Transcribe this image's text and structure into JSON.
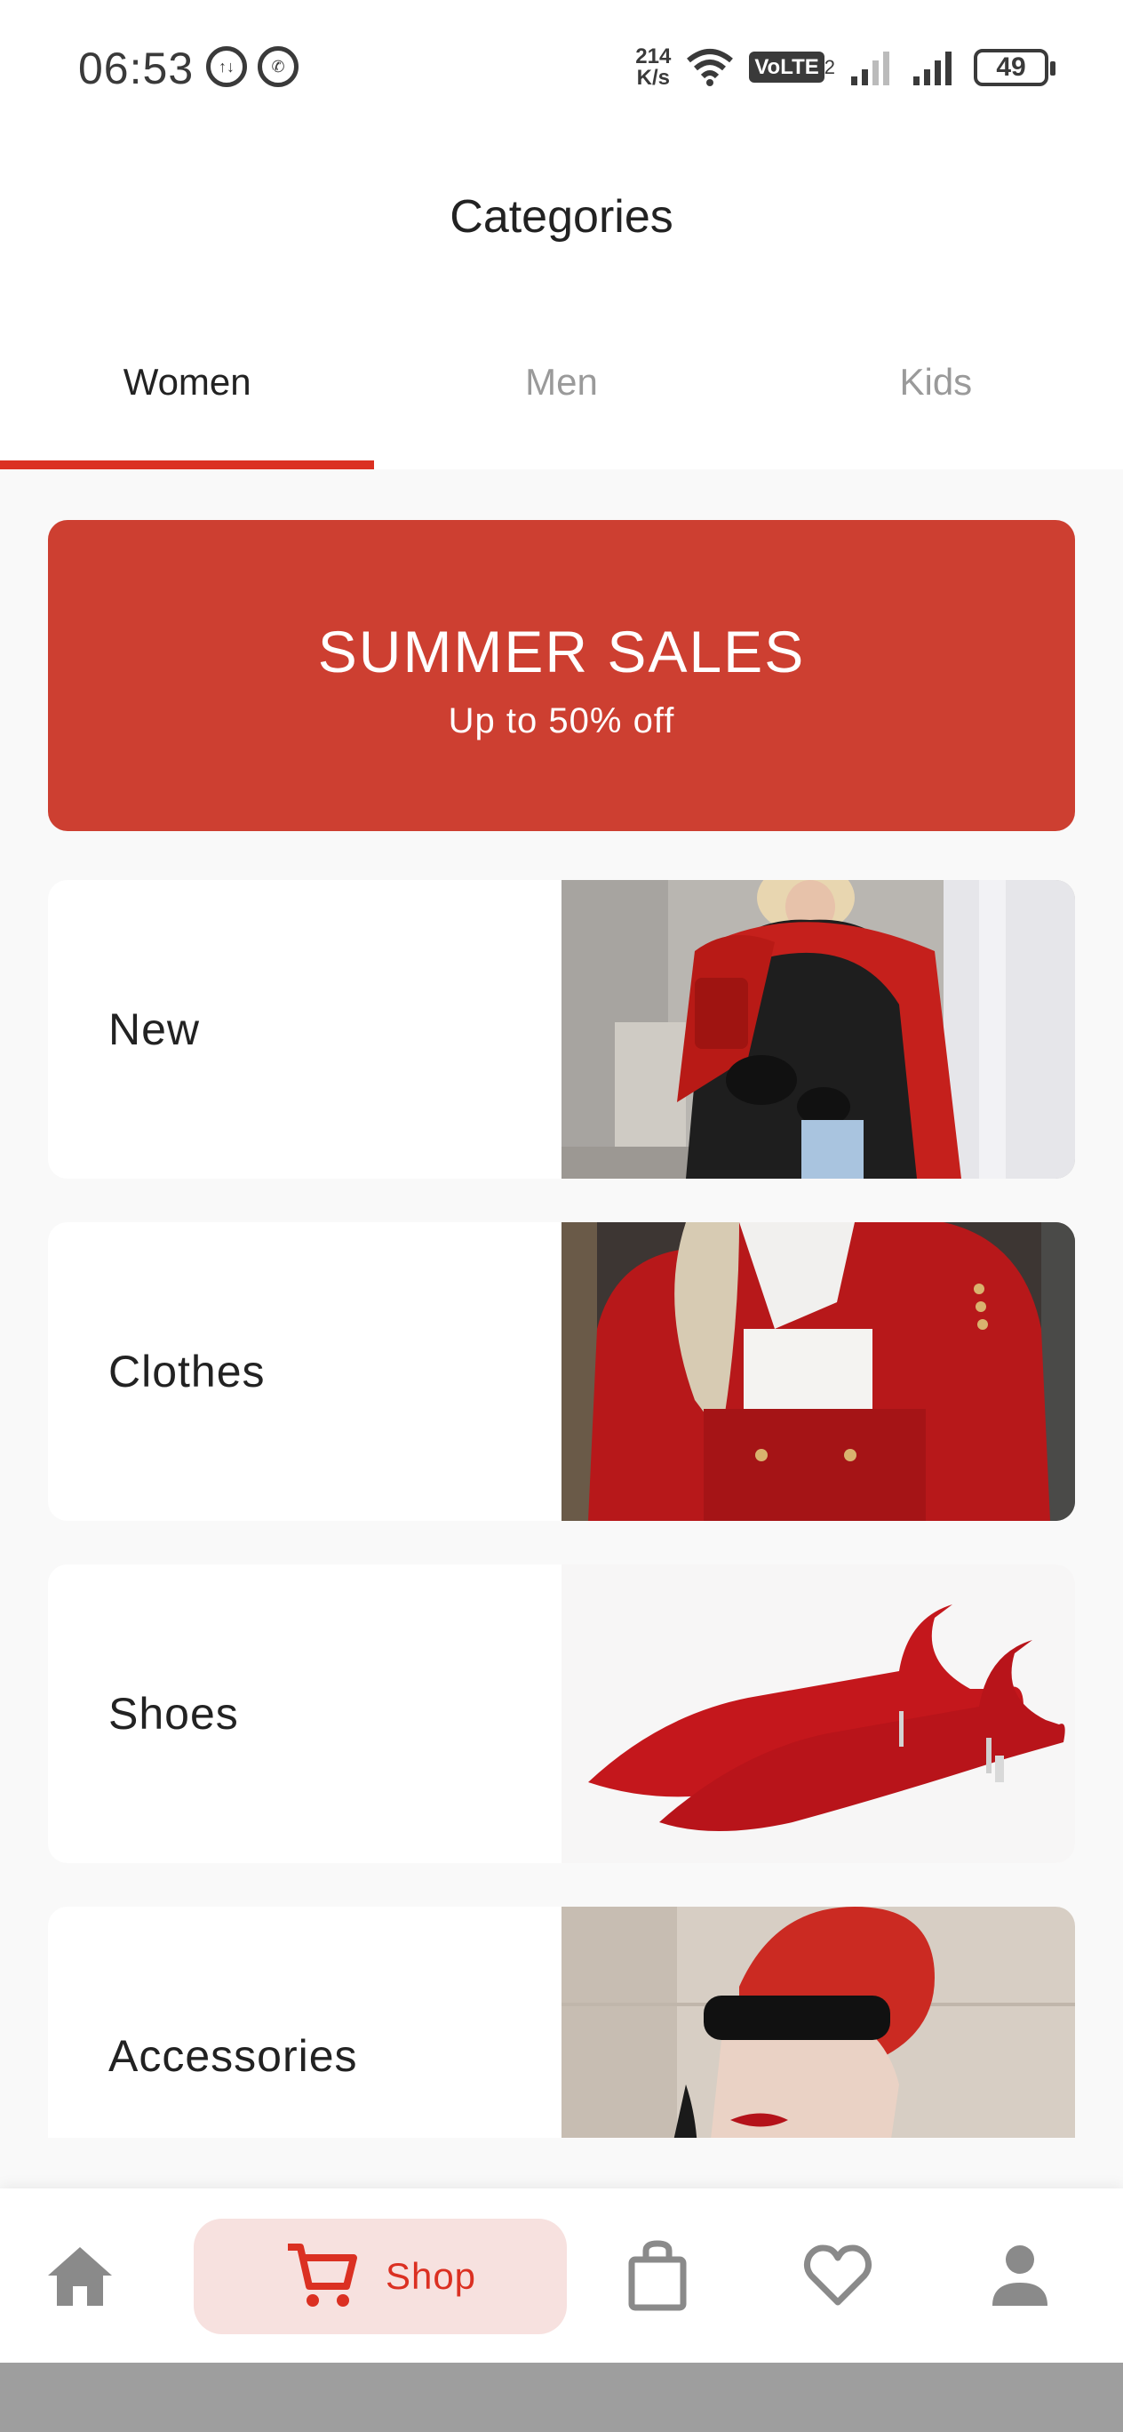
{
  "status_bar": {
    "time": "06:53",
    "net_speed_top": "214",
    "net_speed_bottom": "K/s",
    "volte": "VoLTE",
    "sim_index": "2",
    "battery": "49"
  },
  "header": {
    "title": "Categories"
  },
  "tabs": [
    {
      "label": "Women",
      "active": true
    },
    {
      "label": "Men",
      "active": false
    },
    {
      "label": "Kids",
      "active": false
    }
  ],
  "banner": {
    "title": "SUMMER SALES",
    "subtitle": "Up to 50% off"
  },
  "categories": [
    {
      "label": "New"
    },
    {
      "label": "Clothes"
    },
    {
      "label": "Shoes"
    },
    {
      "label": "Accessories"
    }
  ],
  "bottom_nav": {
    "items": [
      "home-icon",
      "cart-icon",
      "bag-icon",
      "heart-icon",
      "profile-icon"
    ],
    "shop_label": "Shop"
  },
  "colors": {
    "accent": "#db3022",
    "banner": "#cd3f31",
    "pill": "#f7e1df"
  }
}
